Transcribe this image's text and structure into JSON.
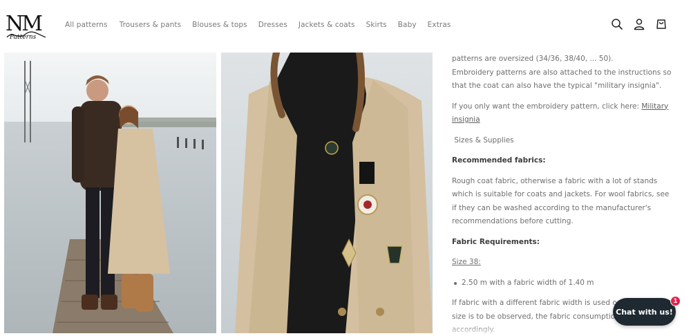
{
  "brand": {
    "logo_alt": "NM Patterns",
    "logo_text_main": "NM",
    "logo_text_script": "Patterns"
  },
  "nav": {
    "items": [
      {
        "label": "All patterns"
      },
      {
        "label": "Trousers & pants"
      },
      {
        "label": "Blouses & tops"
      },
      {
        "label": "Dresses"
      },
      {
        "label": "Jackets & coats"
      },
      {
        "label": "Skirts"
      },
      {
        "label": "Baby"
      },
      {
        "label": "Extras"
      }
    ]
  },
  "header_icons": [
    "search-icon",
    "account-icon",
    "cart-icon"
  ],
  "gallery": {
    "image1": "couple-on-pier-photo",
    "image2": "coat-closeup-photo"
  },
  "description": {
    "p1": "patterns are oversized (34/36, 38/40, ... 50).",
    "p2": "Embroidery patterns are also attached to the instructions so that the coat can also have the typical \"military insignia\".",
    "p3_prefix": "If you only want the embroidery pattern, click here: ",
    "p3_link": "Military insignia",
    "sizes_supplies": " Sizes & Supplies",
    "recommended_heading": "Recommended fabrics:",
    "recommended_body": "Rough coat fabric, otherwise a fabric with a lot of stands which is suitable for coats and jackets. For wool fabrics, see if they can be washed according to the manufacturer's recommendations before cutting.",
    "fabric_req_heading": "Fabric Requirements:",
    "size_label": "Size 38:",
    "size_items": [
      "2.50 m with a fabric width of 1.40 m"
    ],
    "note": "If fabric with a different fabric width is used or a different size is to be observed, the fabric consumption will change accordingly."
  },
  "chat": {
    "label": "Chat with us!",
    "badge_count": "1"
  },
  "colors": {
    "chat_bg": "#1e2931",
    "badge_bg": "#e0244b",
    "text": "#6e6e6e",
    "heading": "#3c3c3c"
  }
}
